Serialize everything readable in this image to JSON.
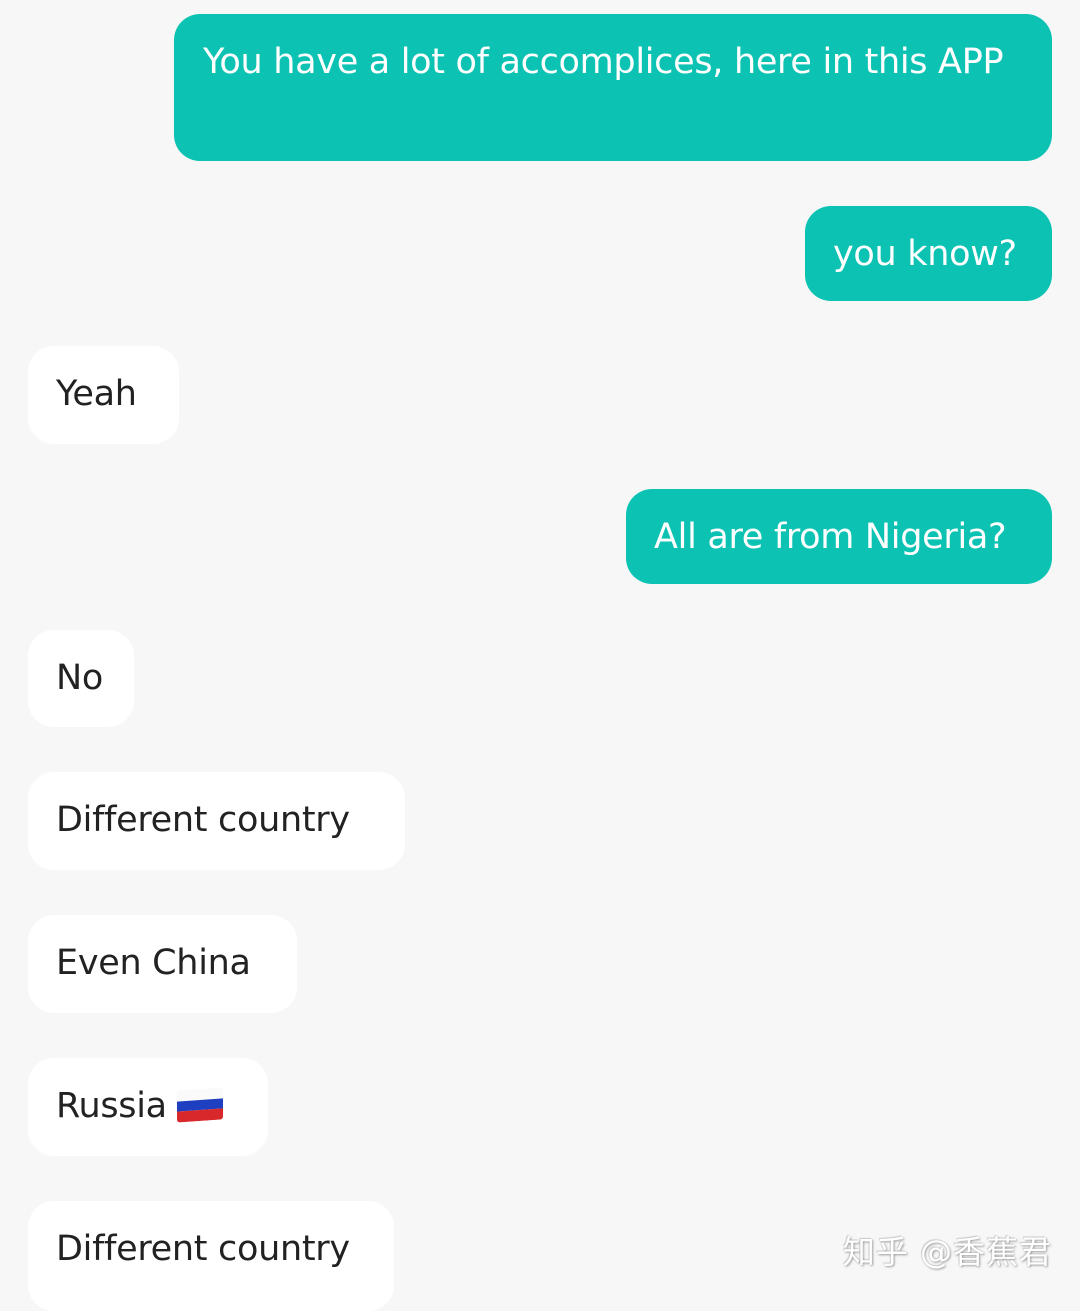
{
  "messages": [
    {
      "side": "sent",
      "text": "You have a lot of accomplices, here in this APP"
    },
    {
      "side": "sent",
      "text": "you know?"
    },
    {
      "side": "received",
      "text": "Yeah"
    },
    {
      "side": "sent",
      "text": "All are from Nigeria?"
    },
    {
      "side": "received",
      "text": "No"
    },
    {
      "side": "received",
      "text": "Different country"
    },
    {
      "side": "received",
      "text": "Even China"
    },
    {
      "side": "received",
      "text": "Russia",
      "emoji": "russia-flag"
    },
    {
      "side": "received",
      "text": "Different country"
    }
  ],
  "colors": {
    "sent_bubble": "#0cc3b3",
    "received_bubble": "#ffffff",
    "background": "#f7f7f8"
  },
  "watermark": "知乎 @香蕉君"
}
